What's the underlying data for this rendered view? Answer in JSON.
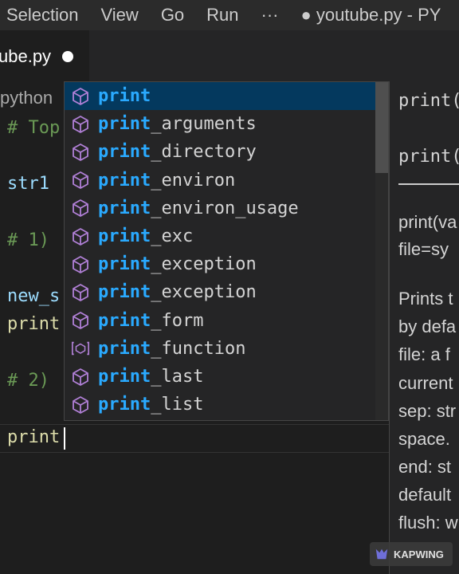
{
  "menubar": {
    "items": [
      "Selection",
      "View",
      "Go",
      "Run",
      "···"
    ],
    "title": "● youtube.py - PY"
  },
  "tab": {
    "label": "ube.py",
    "modified_icon": "dot-icon"
  },
  "editor": {
    "breadcrumb": "python",
    "lines": [
      {
        "text": "# Top",
        "kind": "comment"
      },
      {
        "text": "str1",
        "kind": "var"
      },
      {
        "text": "# 1)",
        "kind": "comment"
      },
      {
        "text": "new_s",
        "kind": "var"
      },
      {
        "text": "print",
        "kind": "fn"
      },
      {
        "text": "# 2)",
        "kind": "comment"
      },
      {
        "text": "print",
        "kind": "fn"
      }
    ]
  },
  "suggest": {
    "match": "print",
    "items": [
      {
        "prefix": "print",
        "suffix": "",
        "icon": "cube-icon"
      },
      {
        "prefix": "print",
        "suffix": "_arguments",
        "icon": "cube-icon"
      },
      {
        "prefix": "print",
        "suffix": "_directory",
        "icon": "cube-icon"
      },
      {
        "prefix": "print",
        "suffix": "_environ",
        "icon": "cube-icon"
      },
      {
        "prefix": "print",
        "suffix": "_environ_usage",
        "icon": "cube-icon"
      },
      {
        "prefix": "print",
        "suffix": "_exc",
        "icon": "cube-icon"
      },
      {
        "prefix": "print",
        "suffix": "_exception",
        "icon": "cube-icon"
      },
      {
        "prefix": "print",
        "suffix": "_exception",
        "icon": "cube-icon"
      },
      {
        "prefix": "print",
        "suffix": "_form",
        "icon": "cube-icon"
      },
      {
        "prefix": "print",
        "suffix": "_function",
        "icon": "method-icon"
      },
      {
        "prefix": "print",
        "suffix": "_last",
        "icon": "cube-icon"
      },
      {
        "prefix": "print",
        "suffix": "_list",
        "icon": "cube-icon"
      }
    ],
    "selected_index": 0
  },
  "details": {
    "lines": [
      {
        "text": "print(",
        "code": true
      },
      {
        "text": "print(",
        "code": true
      },
      {
        "text": "print(va",
        "code": false
      },
      {
        "text": "file=sy",
        "code": false
      },
      {
        "text": "Prints t",
        "code": false
      },
      {
        "text": "by defa",
        "code": false
      },
      {
        "text": "file: a f",
        "code": false
      },
      {
        "text": "current",
        "code": false
      },
      {
        "text": "sep: str",
        "code": false
      },
      {
        "text": "space.",
        "code": false
      },
      {
        "text": "end: st",
        "code": false
      },
      {
        "text": "default",
        "code": false
      },
      {
        "text": "flush: w",
        "code": false
      }
    ]
  },
  "watermark": {
    "text": "KAPWING"
  },
  "colors": {
    "accent": "#2aaaff",
    "selection": "#04395e",
    "icon_purple": "#b180d7",
    "comment": "#6a9955"
  }
}
